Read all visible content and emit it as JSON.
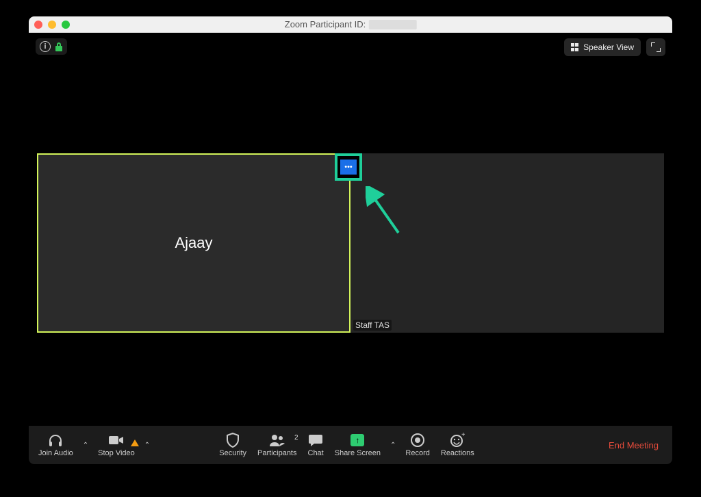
{
  "window": {
    "title_prefix": "Zoom Participant ID:"
  },
  "top": {
    "speaker_view": "Speaker View"
  },
  "participants": {
    "left_name": "Ajaay",
    "right_name": "Staff TAS"
  },
  "more": {
    "dots": "•••"
  },
  "toolbar": {
    "join_audio": "Join Audio",
    "stop_video": "Stop Video",
    "security": "Security",
    "participants": "Participants",
    "participants_count": "2",
    "chat": "Chat",
    "share_screen": "Share Screen",
    "share_arrow": "↑",
    "record": "Record",
    "reactions": "Reactions",
    "end": "End Meeting"
  }
}
